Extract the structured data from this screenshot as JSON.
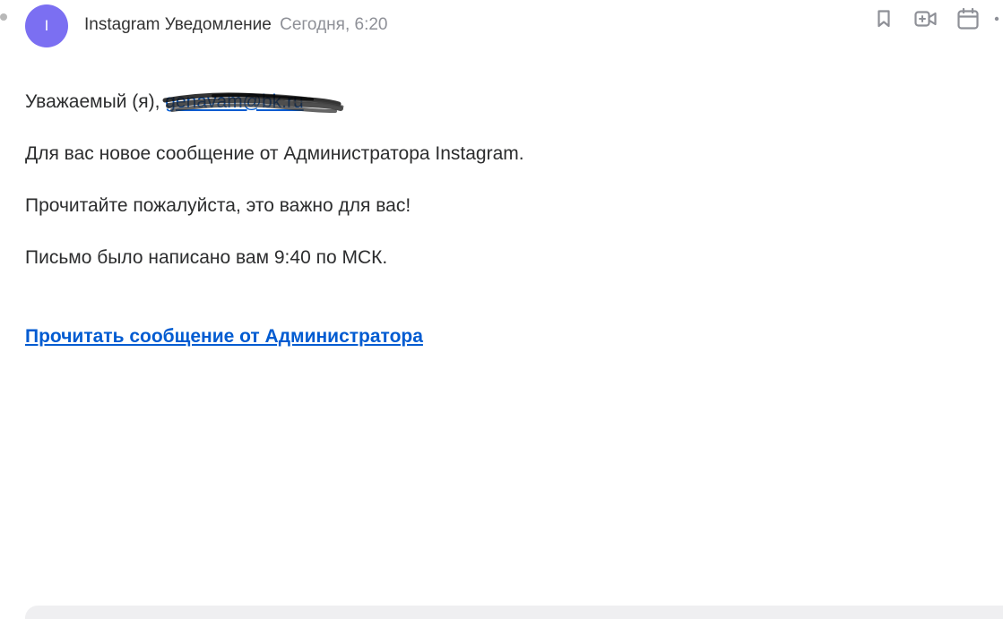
{
  "message": {
    "avatar_letter": "I",
    "sender": "Instagram Уведомление",
    "date": "Сегодня, 6:20",
    "avatar_color": "#7b6ff2"
  },
  "toolbar": {
    "icons": [
      "bookmark-icon",
      "video-call-icon",
      "calendar-icon",
      "more-icon"
    ]
  },
  "body": {
    "greeting": "Уважаемый (я), ",
    "email": "genavam@bk.ru",
    "line1": "Для вас новое сообщение от Администратора Instagram.",
    "line2": "Прочитайте пожалуйста, это важно для вас!",
    "line3": "Письмо было написано вам 9:40 по МСК.",
    "cta": "Прочитать сообщение от Администратора"
  },
  "colors": {
    "link": "#005bd1",
    "text": "#2c2d2e",
    "muted": "#8e9097"
  }
}
